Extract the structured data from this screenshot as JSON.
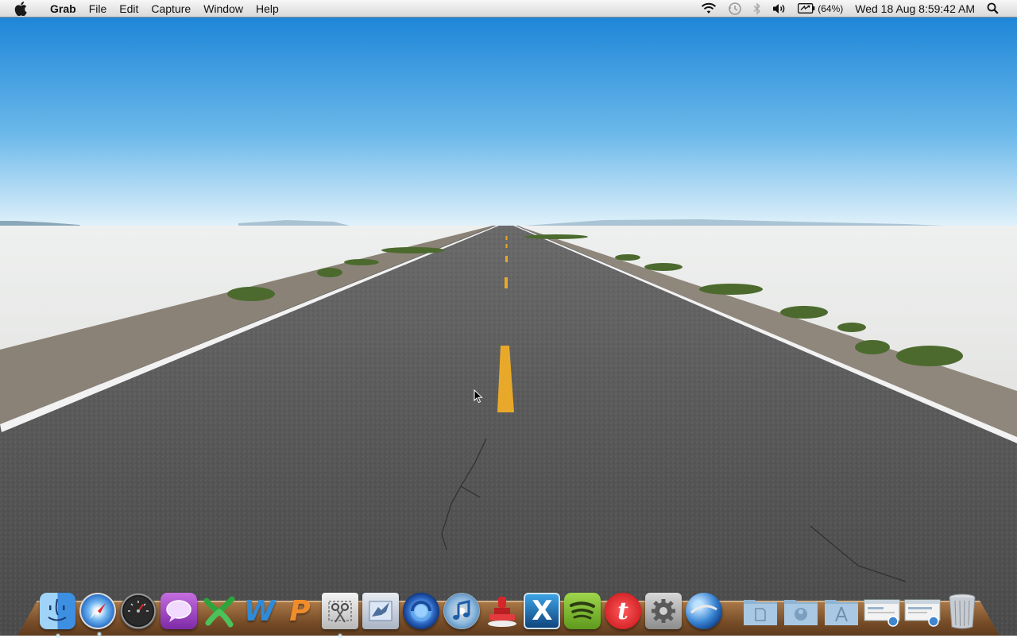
{
  "menubar": {
    "app_name": "Grab",
    "menus": [
      "File",
      "Edit",
      "Capture",
      "Window",
      "Help"
    ],
    "status_icons": [
      "wifi-icon",
      "time-machine-icon",
      "bluetooth-icon",
      "volume-icon",
      "battery-icon",
      "spotlight-icon"
    ],
    "battery_percent": "(64%)",
    "clock": "Wed 18 Aug  8:59:42 AM"
  },
  "dock": {
    "apps": [
      {
        "name": "finder",
        "running": true
      },
      {
        "name": "safari",
        "running": true
      },
      {
        "name": "dashboard",
        "running": false
      },
      {
        "name": "ichat",
        "running": false
      },
      {
        "name": "excel",
        "running": false
      },
      {
        "name": "word",
        "running": false
      },
      {
        "name": "powerpoint",
        "running": false
      },
      {
        "name": "grab",
        "running": true
      },
      {
        "name": "mail",
        "running": false
      },
      {
        "name": "xcode-app",
        "running": false
      },
      {
        "name": "itunes",
        "running": false
      },
      {
        "name": "stamp-app",
        "running": false
      },
      {
        "name": "x11",
        "running": false
      },
      {
        "name": "spotify",
        "running": false
      },
      {
        "name": "t-app",
        "running": false
      },
      {
        "name": "system-preferences",
        "running": false
      },
      {
        "name": "google-earth",
        "running": false
      }
    ],
    "folders": [
      "documents-stack",
      "downloads-stack",
      "applications-stack",
      "web-stack-1",
      "web-stack-2",
      "trash"
    ],
    "glyphs": {
      "word": "W",
      "t-app": "t",
      "x11": "X",
      "powerpoint": "P"
    }
  },
  "colors": {
    "sky_top": "#1e86d8",
    "sky_horizon": "#e6f4fb",
    "asphalt": "#585858",
    "center_line": "#e8a92a",
    "salt_flat": "#e4e4e2",
    "dock_wood": "#8a5a2e"
  }
}
